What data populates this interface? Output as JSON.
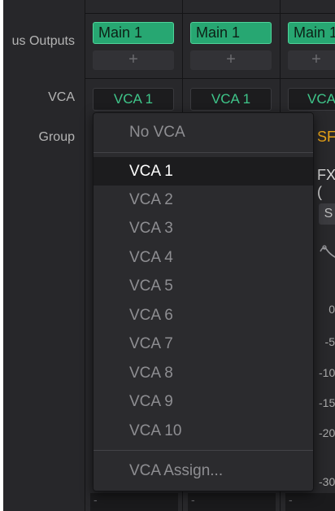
{
  "row_labels": {
    "bus_outputs": "us Outputs",
    "vca": "VCA",
    "group": "Group"
  },
  "strips": [
    {
      "output": "Main 1",
      "add": "+",
      "vca": "VCA 1",
      "bottom": "-"
    },
    {
      "output": "Main 1",
      "add": "+",
      "vca": "VCA 1",
      "bottom": "-"
    },
    {
      "output": "Main 1",
      "add": "+",
      "vca": "VCA",
      "bottom": "-"
    }
  ],
  "right_strip": {
    "group": "SFX",
    "fx": "FX (",
    "solo": "S",
    "scale": [
      "0",
      "-5",
      "-10",
      "-15",
      "-20",
      "-30"
    ]
  },
  "vca_menu": {
    "no_vca": "No VCA",
    "selected": "VCA 1",
    "items": [
      "VCA 1",
      "VCA 2",
      "VCA 3",
      "VCA 4",
      "VCA 5",
      "VCA 6",
      "VCA 7",
      "VCA 8",
      "VCA 9",
      "VCA 10"
    ],
    "assign": "VCA Assign..."
  },
  "colors": {
    "output_green": "#27a772",
    "vca_text": "#3fc68a",
    "group_accent": "#e8a317"
  }
}
